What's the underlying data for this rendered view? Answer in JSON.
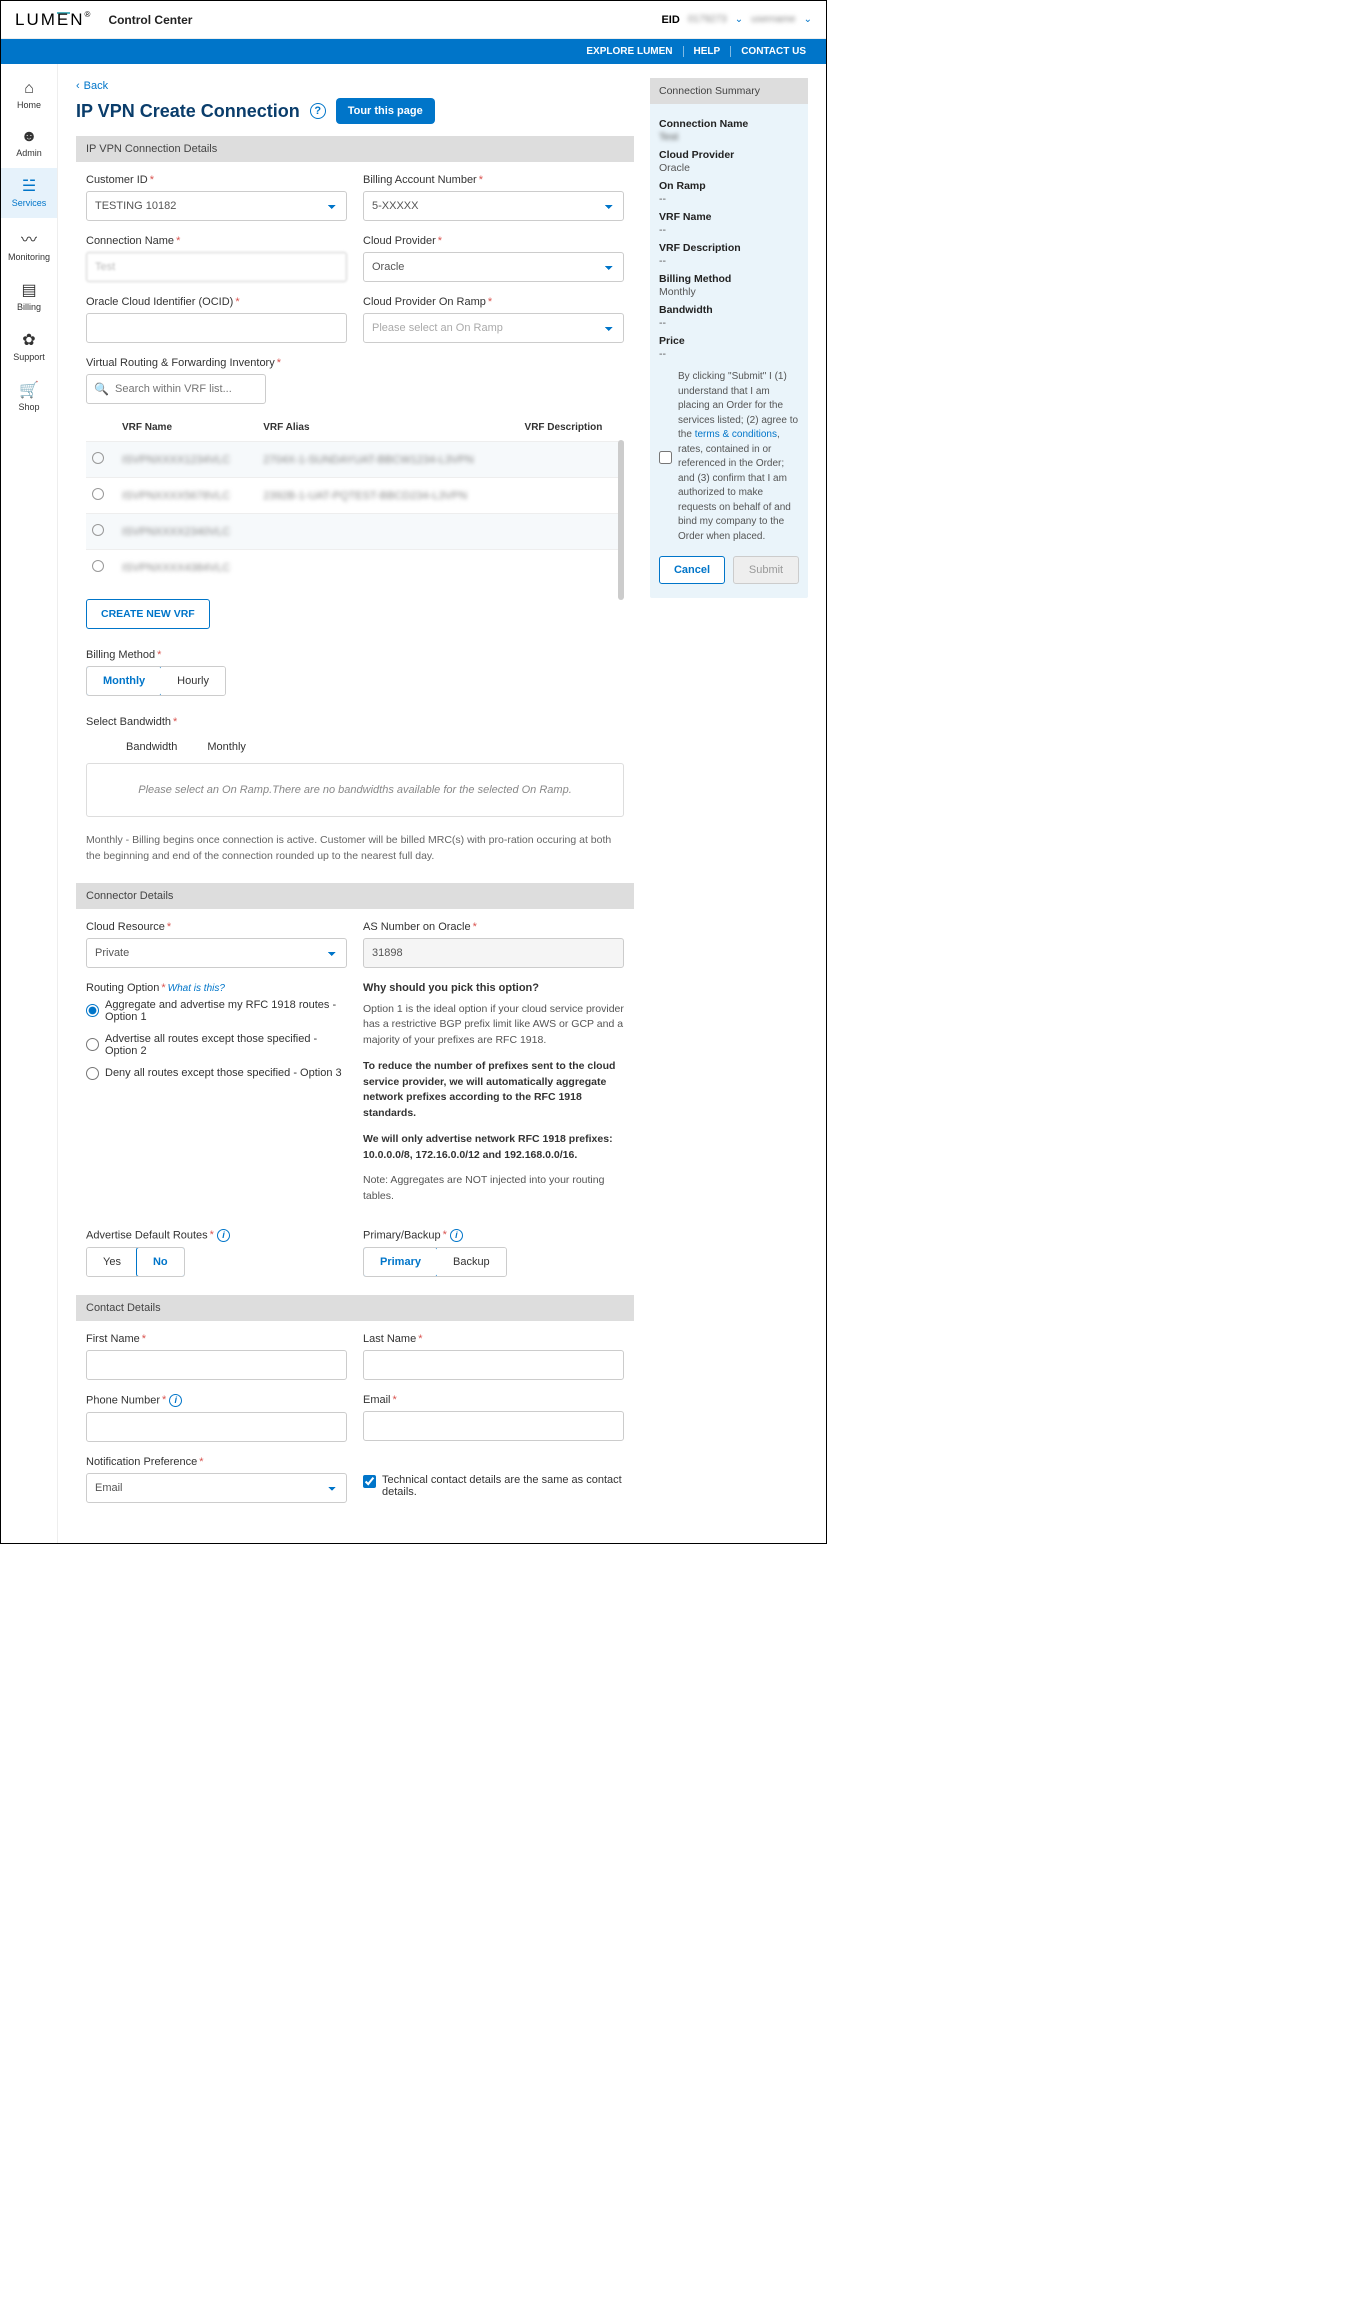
{
  "header": {
    "brand": "LUMEN",
    "title": "Control Center",
    "eid_prefix": "EID",
    "eid_value": "0179273",
    "user": "username"
  },
  "bluebar": {
    "explore": "EXPLORE LUMEN",
    "help": "HELP",
    "contact": "CONTACT US"
  },
  "nav": {
    "home": "Home",
    "admin": "Admin",
    "services": "Services",
    "monitoring": "Monitoring",
    "billing": "Billing",
    "support": "Support",
    "shop": "Shop"
  },
  "back": "Back",
  "page_title": "IP VPN Create Connection",
  "tour": "Tour this page",
  "sec1": {
    "title": "IP VPN Connection Details",
    "customer_id_lbl": "Customer ID",
    "customer_id_val": "TESTING 10182",
    "ban_lbl": "Billing Account Number",
    "ban_val": "5-XXXXX",
    "conn_name_lbl": "Connection Name",
    "conn_name_val": "Test",
    "cloud_provider_lbl": "Cloud Provider",
    "cloud_provider_val": "Oracle",
    "ocid_lbl": "Oracle Cloud Identifier (OCID)",
    "ocid_val": "",
    "onramp_lbl": "Cloud Provider On Ramp",
    "onramp_ph": "Please select an On Ramp",
    "vrf_lbl": "Virtual Routing & Forwarding Inventory",
    "vrf_search_ph": "Search within VRF list...",
    "vrf_cols": {
      "name": "VRF Name",
      "alias": "VRF Alias",
      "desc": "VRF Description"
    },
    "vrf_rows": [
      {
        "name": "ISVPNXXXX1234VLC",
        "alias": "2704X-1-SUNDAYUAT-BBCW1234-L3VPN",
        "desc": ""
      },
      {
        "name": "ISVPNXXXX5678VLC",
        "alias": "2392B-1-UAT-PQTEST-BBCD234-L3VPN",
        "desc": ""
      },
      {
        "name": "ISVPNXXXX2340VLC",
        "alias": "",
        "desc": ""
      },
      {
        "name": "ISVPNXXXX4384VLC",
        "alias": "",
        "desc": ""
      }
    ],
    "new_vrf": "CREATE NEW VRF",
    "billing_method_lbl": "Billing Method",
    "billing_monthly": "Monthly",
    "billing_hourly": "Hourly",
    "bw_lbl": "Select Bandwidth",
    "bw_col1": "Bandwidth",
    "bw_col2": "Monthly",
    "bw_empty": "Please select an On Ramp.There are no bandwidths available for the selected On Ramp.",
    "note": "Monthly - Billing begins once connection is active. Customer will be billed MRC(s) with pro-ration occuring at both the beginning and end of the connection rounded up to the nearest full day."
  },
  "sec2": {
    "title": "Connector Details",
    "cloud_res_lbl": "Cloud Resource",
    "cloud_res_val": "Private",
    "asn_lbl": "AS Number on Oracle",
    "asn_val": "31898",
    "routing_lbl": "Routing Option",
    "what": "What is this?",
    "opt1": "Aggregate and advertise my RFC 1918 routes - Option 1",
    "opt2": "Advertise all routes except those specified - Option 2",
    "opt3": "Deny all routes except those specified - Option 3",
    "why_head": "Why should you pick this option?",
    "why1": "Option 1 is the ideal option if your cloud service provider has a restrictive BGP prefix limit like AWS or GCP and a majority of your prefixes are RFC 1918.",
    "why2": "To reduce the number of prefixes sent to the cloud service provider, we will automatically aggregate network prefixes according to the RFC 1918 standards.",
    "why3": "We will only advertise network RFC 1918 prefixes: 10.0.0.0/8, 172.16.0.0/12 and 192.168.0.0/16.",
    "why4": "Note: Aggregates are NOT injected into your routing tables.",
    "adr_lbl": "Advertise Default Routes",
    "yes": "Yes",
    "no": "No",
    "pb_lbl": "Primary/Backup",
    "primary": "Primary",
    "backup": "Backup"
  },
  "sec3": {
    "title": "Contact Details",
    "fn_lbl": "First Name",
    "ln_lbl": "Last Name",
    "ph_lbl": "Phone Number",
    "em_lbl": "Email",
    "np_lbl": "Notification Preference",
    "np_val": "Email",
    "same_contact": "Technical contact details are the same as contact details."
  },
  "summary": {
    "title": "Connection Summary",
    "cn_lbl": "Connection Name",
    "cn_val": "Test",
    "cp_lbl": "Cloud Provider",
    "cp_val": "Oracle",
    "or_lbl": "On Ramp",
    "or_val": "--",
    "vn_lbl": "VRF Name",
    "vn_val": "--",
    "vd_lbl": "VRF Description",
    "vd_val": "--",
    "bm_lbl": "Billing Method",
    "bm_val": "Monthly",
    "bw_lbl": "Bandwidth",
    "bw_val": "--",
    "pr_lbl": "Price",
    "pr_val": "--",
    "consent_pre": "By clicking \"Submit\" I (1) understand that I am placing an Order for the services listed; (2) agree to the ",
    "tc": "terms & conditions",
    "consent_post": ", rates, contained in or referenced in the Order; and (3) confirm that I am authorized to make requests on behalf of and bind my company to the Order when placed.",
    "cancel": "Cancel",
    "submit": "Submit"
  }
}
